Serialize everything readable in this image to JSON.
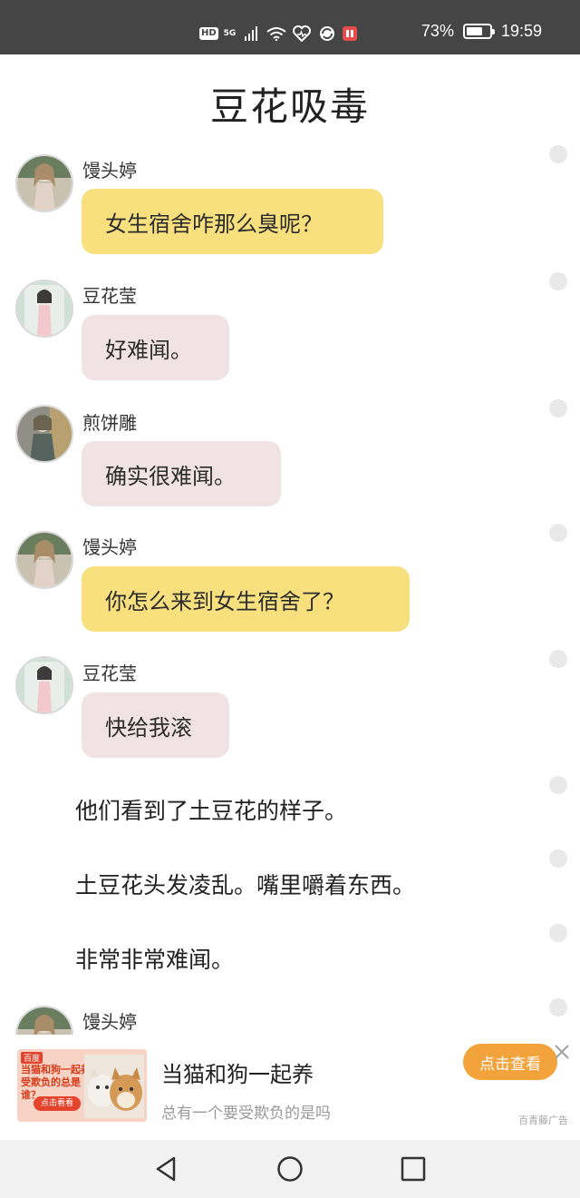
{
  "status_bar": {
    "hd": "HD",
    "network": "5G",
    "battery": "73%",
    "battery_level": 0.73,
    "time": "19:59",
    "icons": [
      "hd-icon",
      "5g-signal-icon",
      "wifi-icon",
      "heart-icon",
      "sync-icon",
      "red-app-icon",
      "battery-icon"
    ]
  },
  "page": {
    "title": "豆花吸毒"
  },
  "messages": [
    {
      "sender": "馒头婷",
      "text": "女生宿舍咋那么臭呢？",
      "color": "#f9e07e"
    },
    {
      "sender": "豆花莹",
      "text": "好难闻。",
      "color": "#f1e3e3"
    },
    {
      "sender": "煎饼雕",
      "text": "确实很难闻。",
      "color": "#f1e3e3"
    },
    {
      "sender": "馒头婷",
      "text": "你怎么来到女生宿舍了？",
      "color": "#f9e07e"
    },
    {
      "sender": "豆花莹",
      "text": "快给我滚",
      "color": "#f1e3e3"
    }
  ],
  "narration": [
    "他们看到了土豆花的样子。",
    "土豆花头发凌乱。嘴里嚼着东西。",
    "非常非常难闻。"
  ],
  "partial_message": {
    "sender": "馒头婷"
  },
  "ad": {
    "title": "当猫和狗一起养",
    "subtitle": "总有一个要受欺负的是吗",
    "cta": "点击查看",
    "source": "百青藤广告",
    "image_logo": "百度",
    "image_text": "当猫和狗一起养 受欺负的总是谁？",
    "image_button": "点击看看",
    "cta_color": "#f2a33c"
  },
  "nav_bar": {
    "icons": [
      "back-triangle-icon",
      "home-circle-icon",
      "recents-square-icon"
    ]
  }
}
